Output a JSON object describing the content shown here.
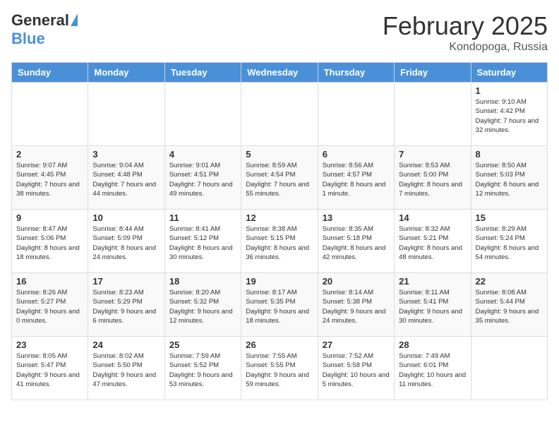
{
  "logo": {
    "general": "General",
    "blue": "Blue"
  },
  "title": "February 2025",
  "location": "Kondopoga, Russia",
  "days_of_week": [
    "Sunday",
    "Monday",
    "Tuesday",
    "Wednesday",
    "Thursday",
    "Friday",
    "Saturday"
  ],
  "weeks": [
    [
      {
        "day": "",
        "info": ""
      },
      {
        "day": "",
        "info": ""
      },
      {
        "day": "",
        "info": ""
      },
      {
        "day": "",
        "info": ""
      },
      {
        "day": "",
        "info": ""
      },
      {
        "day": "",
        "info": ""
      },
      {
        "day": "1",
        "info": "Sunrise: 9:10 AM\nSunset: 4:42 PM\nDaylight: 7 hours and 32 minutes."
      }
    ],
    [
      {
        "day": "2",
        "info": "Sunrise: 9:07 AM\nSunset: 4:45 PM\nDaylight: 7 hours and 38 minutes."
      },
      {
        "day": "3",
        "info": "Sunrise: 9:04 AM\nSunset: 4:48 PM\nDaylight: 7 hours and 44 minutes."
      },
      {
        "day": "4",
        "info": "Sunrise: 9:01 AM\nSunset: 4:51 PM\nDaylight: 7 hours and 49 minutes."
      },
      {
        "day": "5",
        "info": "Sunrise: 8:59 AM\nSunset: 4:54 PM\nDaylight: 7 hours and 55 minutes."
      },
      {
        "day": "6",
        "info": "Sunrise: 8:56 AM\nSunset: 4:57 PM\nDaylight: 8 hours and 1 minute."
      },
      {
        "day": "7",
        "info": "Sunrise: 8:53 AM\nSunset: 5:00 PM\nDaylight: 8 hours and 7 minutes."
      },
      {
        "day": "8",
        "info": "Sunrise: 8:50 AM\nSunset: 5:03 PM\nDaylight: 8 hours and 12 minutes."
      }
    ],
    [
      {
        "day": "9",
        "info": "Sunrise: 8:47 AM\nSunset: 5:06 PM\nDaylight: 8 hours and 18 minutes."
      },
      {
        "day": "10",
        "info": "Sunrise: 8:44 AM\nSunset: 5:09 PM\nDaylight: 8 hours and 24 minutes."
      },
      {
        "day": "11",
        "info": "Sunrise: 8:41 AM\nSunset: 5:12 PM\nDaylight: 8 hours and 30 minutes."
      },
      {
        "day": "12",
        "info": "Sunrise: 8:38 AM\nSunset: 5:15 PM\nDaylight: 8 hours and 36 minutes."
      },
      {
        "day": "13",
        "info": "Sunrise: 8:35 AM\nSunset: 5:18 PM\nDaylight: 8 hours and 42 minutes."
      },
      {
        "day": "14",
        "info": "Sunrise: 8:32 AM\nSunset: 5:21 PM\nDaylight: 8 hours and 48 minutes."
      },
      {
        "day": "15",
        "info": "Sunrise: 8:29 AM\nSunset: 5:24 PM\nDaylight: 8 hours and 54 minutes."
      }
    ],
    [
      {
        "day": "16",
        "info": "Sunrise: 8:26 AM\nSunset: 5:27 PM\nDaylight: 9 hours and 0 minutes."
      },
      {
        "day": "17",
        "info": "Sunrise: 8:23 AM\nSunset: 5:29 PM\nDaylight: 9 hours and 6 minutes."
      },
      {
        "day": "18",
        "info": "Sunrise: 8:20 AM\nSunset: 5:32 PM\nDaylight: 9 hours and 12 minutes."
      },
      {
        "day": "19",
        "info": "Sunrise: 8:17 AM\nSunset: 5:35 PM\nDaylight: 9 hours and 18 minutes."
      },
      {
        "day": "20",
        "info": "Sunrise: 8:14 AM\nSunset: 5:38 PM\nDaylight: 9 hours and 24 minutes."
      },
      {
        "day": "21",
        "info": "Sunrise: 8:11 AM\nSunset: 5:41 PM\nDaylight: 9 hours and 30 minutes."
      },
      {
        "day": "22",
        "info": "Sunrise: 8:08 AM\nSunset: 5:44 PM\nDaylight: 9 hours and 35 minutes."
      }
    ],
    [
      {
        "day": "23",
        "info": "Sunrise: 8:05 AM\nSunset: 5:47 PM\nDaylight: 9 hours and 41 minutes."
      },
      {
        "day": "24",
        "info": "Sunrise: 8:02 AM\nSunset: 5:50 PM\nDaylight: 9 hours and 47 minutes."
      },
      {
        "day": "25",
        "info": "Sunrise: 7:59 AM\nSunset: 5:52 PM\nDaylight: 9 hours and 53 minutes."
      },
      {
        "day": "26",
        "info": "Sunrise: 7:55 AM\nSunset: 5:55 PM\nDaylight: 9 hours and 59 minutes."
      },
      {
        "day": "27",
        "info": "Sunrise: 7:52 AM\nSunset: 5:58 PM\nDaylight: 10 hours and 5 minutes."
      },
      {
        "day": "28",
        "info": "Sunrise: 7:49 AM\nSunset: 6:01 PM\nDaylight: 10 hours and 11 minutes."
      },
      {
        "day": "",
        "info": ""
      }
    ]
  ]
}
